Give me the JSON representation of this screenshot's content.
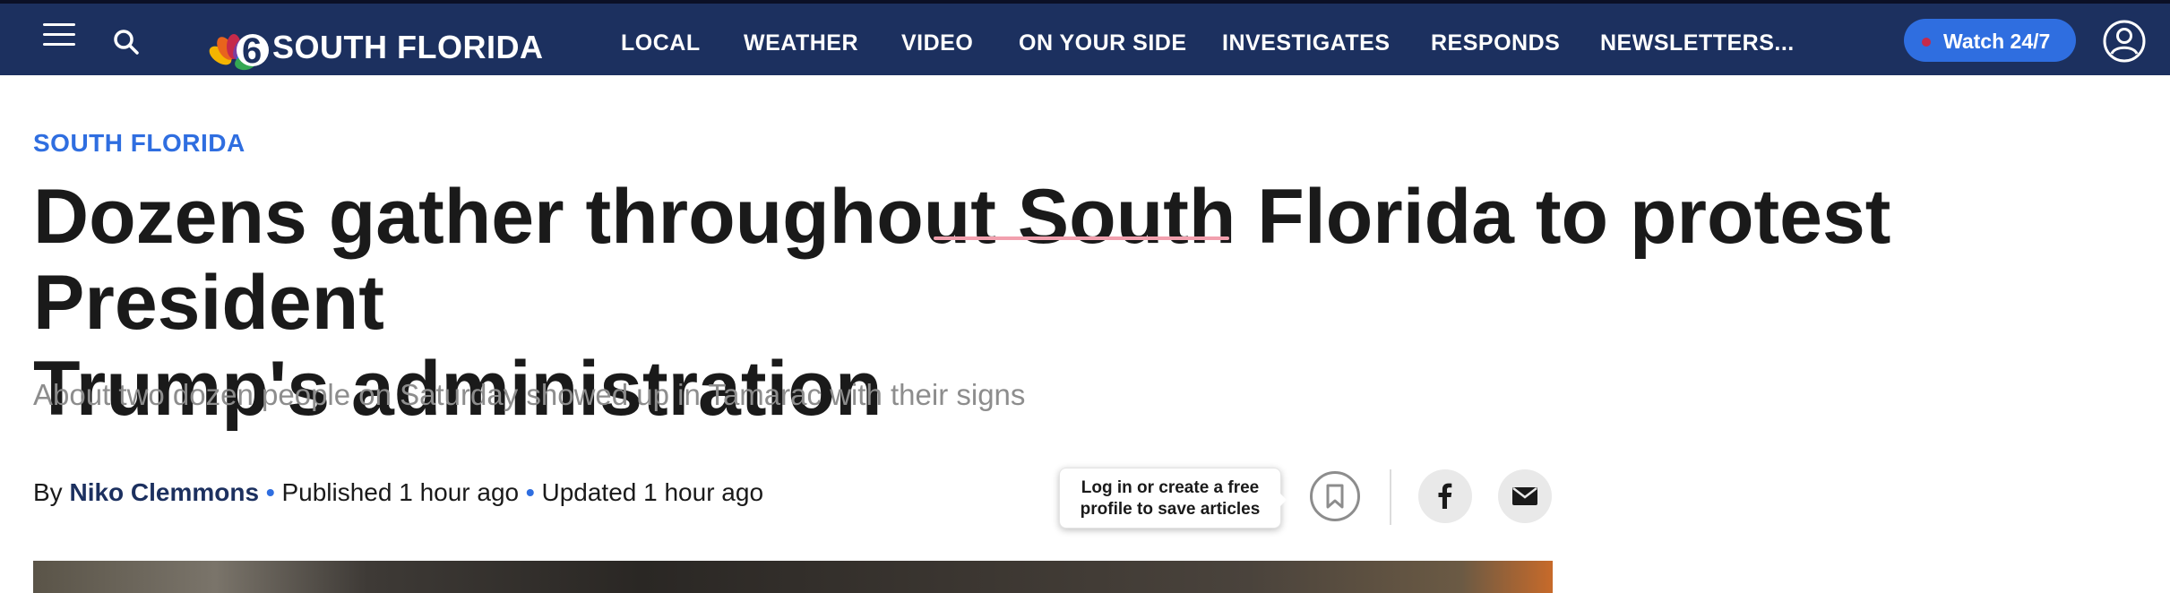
{
  "nav": {
    "menu_icon": "hamburger-menu-icon",
    "search_icon": "search-icon",
    "logo": {
      "channel": "6",
      "text": "SOUTH FLORIDA"
    },
    "items": [
      "LOCAL",
      "WEATHER",
      "VIDEO",
      "ON YOUR SIDE",
      "INVESTIGATES",
      "RESPONDS",
      "NEWSLETTERS..."
    ],
    "watch_label": "Watch 24/7",
    "profile_icon": "user-profile-icon",
    "colors": {
      "bar": "#1c305f",
      "accent": "#2f6ee0",
      "live_dot": "#c62a4a"
    }
  },
  "article": {
    "section": "SOUTH FLORIDA",
    "headline_line1": "Dozens gather throughout South Florida to protest President",
    "headline_line2": "Trump's administration",
    "dek": "About two dozen people on Saturday showed up in Tamarac with their signs",
    "byline": {
      "by": "By",
      "author": "Niko Clemmons",
      "separator": "•",
      "published": "Published 1 hour ago",
      "updated": "Updated 1 hour ago"
    }
  },
  "share": {
    "tooltip_line1": "Log in or create a free",
    "tooltip_line2": "profile to save articles",
    "bookmark_icon": "bookmark-icon",
    "facebook_icon": "facebook-icon",
    "email_icon": "email-icon"
  }
}
